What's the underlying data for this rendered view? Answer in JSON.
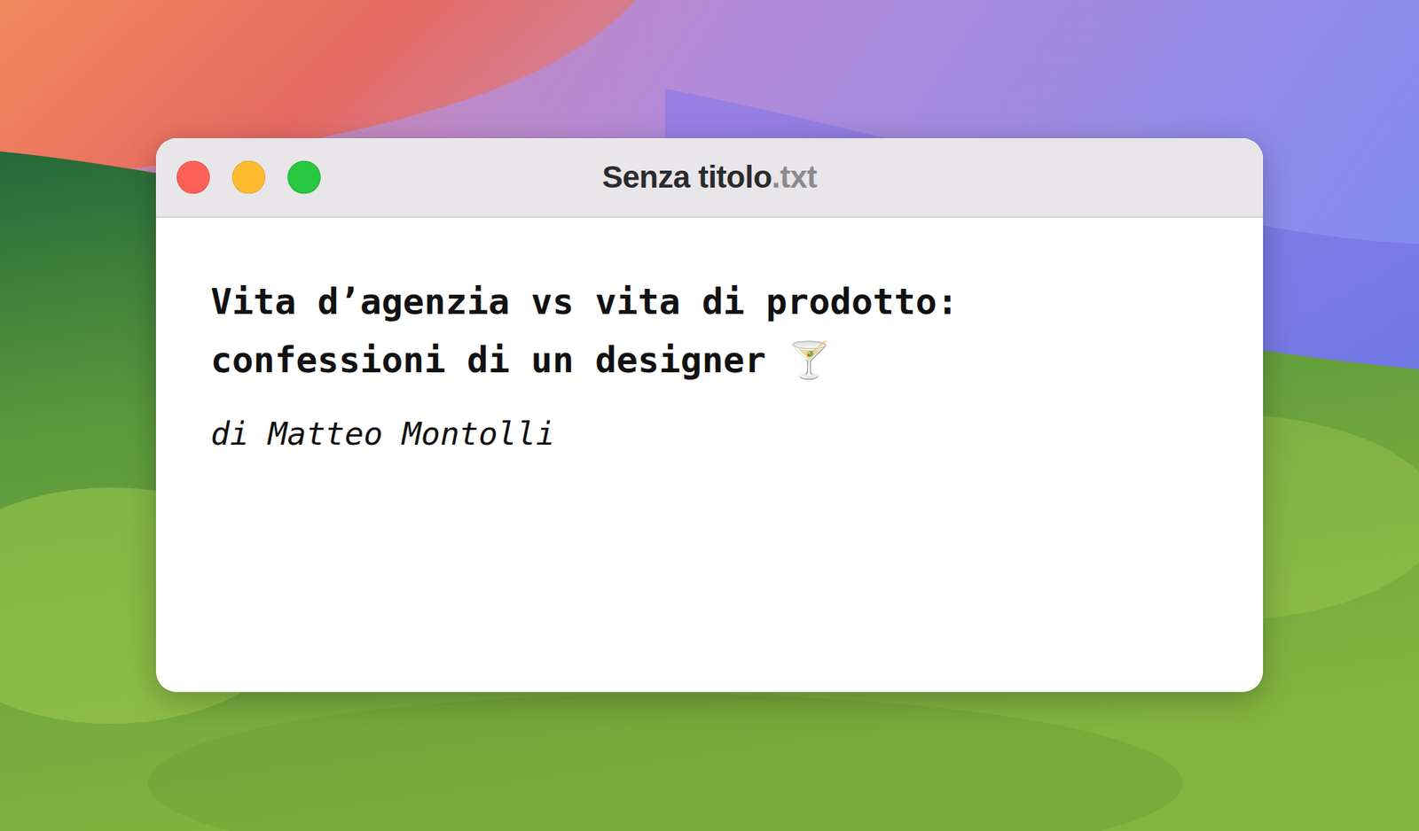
{
  "window": {
    "title": "Senza titolo",
    "extension": ".txt",
    "controls": [
      {
        "kind": "close",
        "color": "#fe5f57"
      },
      {
        "kind": "minimize",
        "color": "#febc2e"
      },
      {
        "kind": "zoom",
        "color": "#28c840"
      }
    ]
  },
  "document": {
    "heading": "Vita d’agenzia vs vita di prodotto: confessioni di un designer 🍸",
    "author": "di Matteo Montolli"
  }
}
